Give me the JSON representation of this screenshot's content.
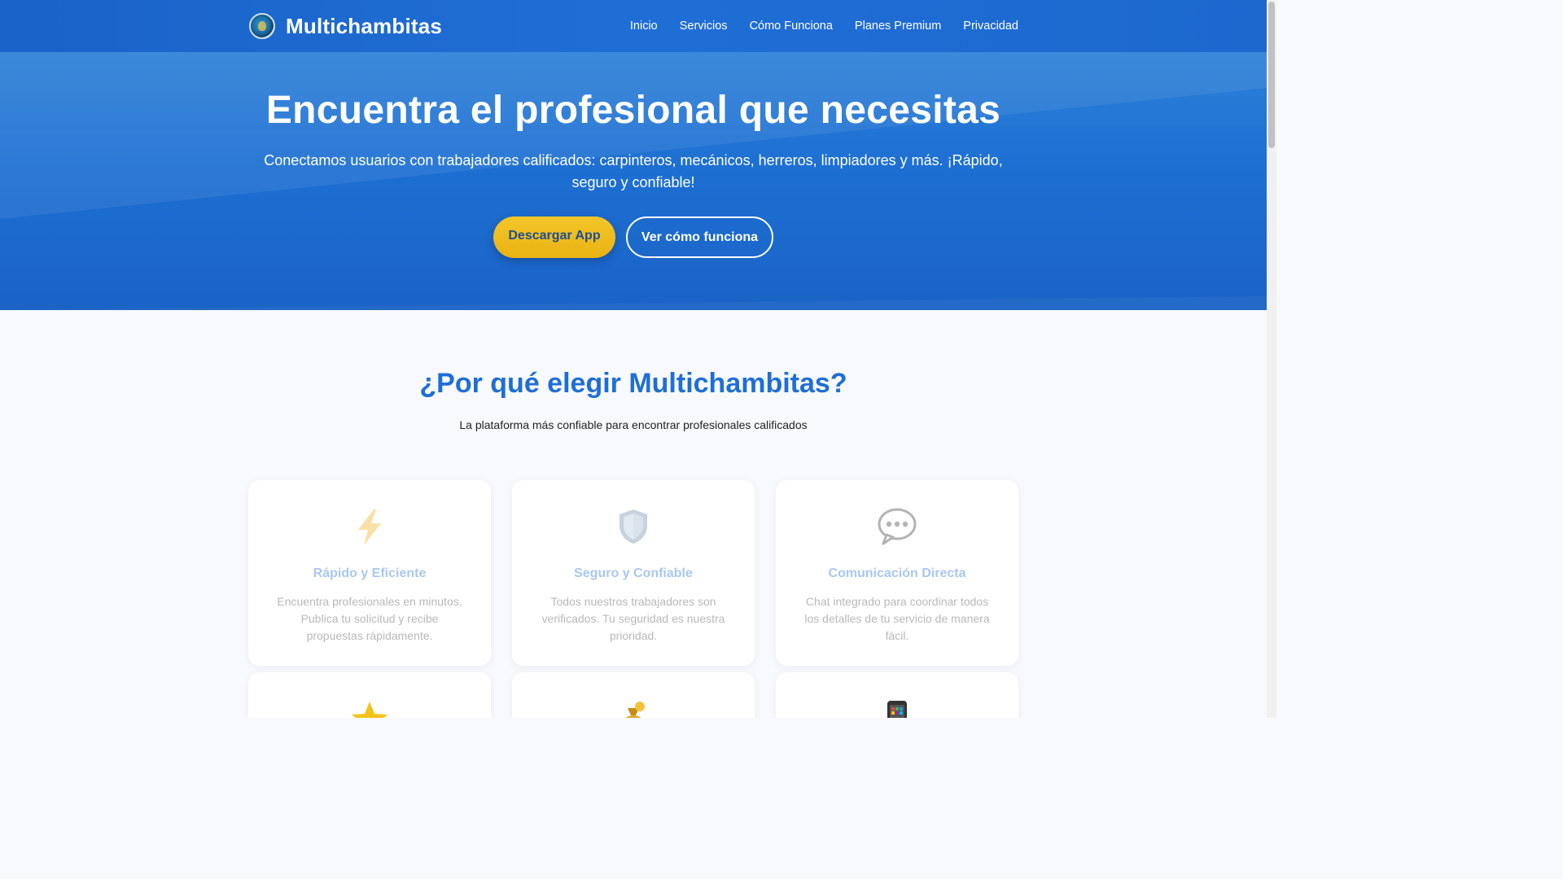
{
  "brand": {
    "name": "Multichambitas",
    "logo": "globe-logo-icon"
  },
  "nav": {
    "items": [
      {
        "label": "Inicio"
      },
      {
        "label": "Servicios"
      },
      {
        "label": "Cómo Funciona"
      },
      {
        "label": "Planes Premium"
      },
      {
        "label": "Privacidad"
      }
    ]
  },
  "hero": {
    "title": "Encuentra el profesional que necesitas",
    "subtitle": "Conectamos usuarios con trabajadores calificados: carpinteros, mecánicos, herreros, limpiadores y más. ¡Rápido, seguro y confiable!",
    "primary_button": "Descargar App",
    "secondary_button": "Ver cómo funciona"
  },
  "features": {
    "title": "¿Por qué elegir Multichambitas?",
    "subtitle": "La plataforma más confiable para encontrar profesionales calificados",
    "cards": [
      {
        "icon": "lightning-icon",
        "title": "Rápido y Eficiente",
        "text": "Encuentra profesionales en minutos. Publica tu solicitud y recibe propuestas rápidamente."
      },
      {
        "icon": "shield-icon",
        "title": "Seguro y Confiable",
        "text": "Todos nuestros trabajadores son verificados. Tu seguridad es nuestra prioridad."
      },
      {
        "icon": "speech-bubble-icon",
        "title": "Comunicación Directa",
        "text": "Chat integrado para coordinar todos los detalles de tu servicio de manera fácil."
      },
      {
        "icon": "star-icon"
      },
      {
        "icon": "money-bag-icon"
      },
      {
        "icon": "mobile-phone-icon"
      }
    ]
  },
  "colors": {
    "primary": "#1f6ed6",
    "accent": "#f0be22",
    "background": "#f7f9fc"
  }
}
